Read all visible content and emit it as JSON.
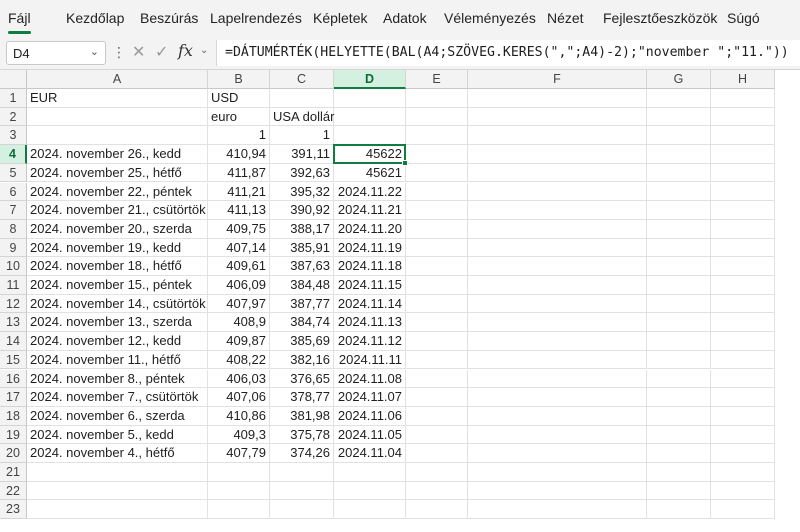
{
  "menu": [
    "Fájl",
    "Kezdőlap",
    "Beszúrás",
    "Lapelrendezés",
    "Képletek",
    "Adatok",
    "Véleményezés",
    "Nézet",
    "Fejlesztőeszközök",
    "Súgó"
  ],
  "formula_bar": {
    "name_box": "D4",
    "cancel_icon": "✕",
    "enter_icon": "✓",
    "fx_label": "fx",
    "formula": "=DÁTUMÉRTÉK(HELYETTE(BAL(A4;SZÖVEG.KERES(\",\";A4)-2);\"november \";\"11.\"))"
  },
  "columns": [
    "A",
    "B",
    "C",
    "D",
    "E",
    "F",
    "G",
    "H"
  ],
  "rows": [
    "1",
    "2",
    "3",
    "4",
    "5",
    "6",
    "7",
    "8",
    "9",
    "10",
    "11",
    "12",
    "13",
    "14",
    "15",
    "16",
    "17",
    "18",
    "19",
    "20",
    "21",
    "22",
    "23"
  ],
  "selected": {
    "column": "D",
    "row": "4"
  },
  "cells": {
    "A": [
      "EUR",
      "",
      "",
      "2024. november 26., kedd",
      "2024. november 25., hétfő",
      "2024. november 22., péntek",
      "2024. november 21., csütörtök",
      "2024. november 20., szerda",
      "2024. november 19., kedd",
      "2024. november 18., hétfő",
      "2024. november 15., péntek",
      "2024. november 14., csütörtök",
      "2024. november 13., szerda",
      "2024. november 12., kedd",
      "2024. november 11., hétfő",
      "2024. november 8., péntek",
      "2024. november 7., csütörtök",
      "2024. november 6., szerda",
      "2024. november 5., kedd",
      "2024. november 4., hétfő",
      "",
      "",
      ""
    ],
    "B": [
      "USD",
      "euro",
      "1",
      "410,94",
      "411,87",
      "411,21",
      "411,13",
      "409,75",
      "407,14",
      "409,61",
      "406,09",
      "407,97",
      "408,9",
      "409,87",
      "408,22",
      "406,03",
      "407,06",
      "410,86",
      "409,3",
      "407,79",
      "",
      "",
      ""
    ],
    "C": [
      "",
      "USA dollár",
      "1",
      "391,11",
      "392,63",
      "395,32",
      "390,92",
      "388,17",
      "385,91",
      "387,63",
      "384,48",
      "387,77",
      "384,74",
      "385,69",
      "382,16",
      "376,65",
      "378,77",
      "381,98",
      "375,78",
      "374,26",
      "",
      "",
      ""
    ],
    "D": [
      "",
      "",
      "",
      "45622",
      "45621",
      "2024.11.22",
      "2024.11.21",
      "2024.11.20",
      "2024.11.19",
      "2024.11.18",
      "2024.11.15",
      "2024.11.14",
      "2024.11.13",
      "2024.11.12",
      "2024.11.11",
      "2024.11.08",
      "2024.11.07",
      "2024.11.06",
      "2024.11.05",
      "2024.11.04",
      "",
      "",
      ""
    ]
  },
  "colors": {
    "accent": "#107c41",
    "header_bg": "#f3f3f3",
    "selected_header_bg": "#d3f0e0"
  }
}
